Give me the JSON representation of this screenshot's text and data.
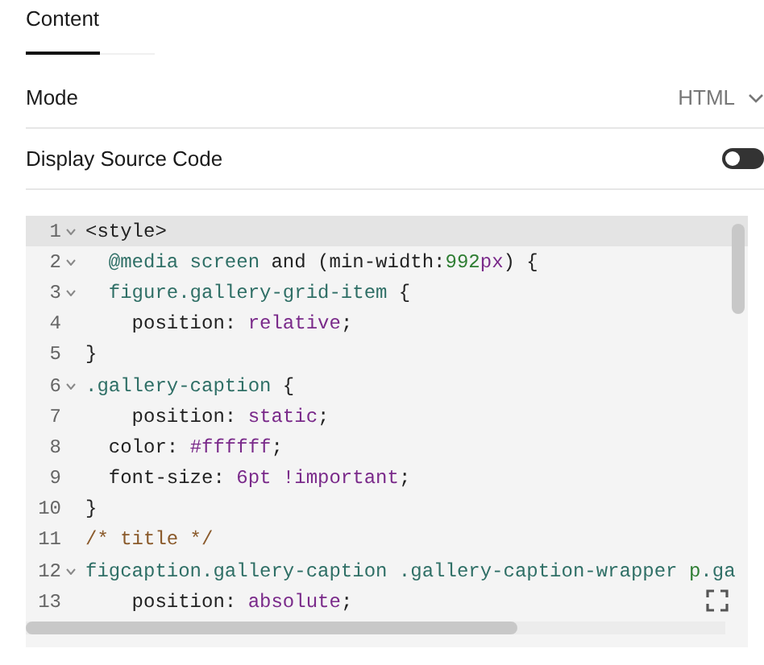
{
  "tabs": [
    {
      "label": "Content",
      "selected": true
    }
  ],
  "settings": [
    {
      "kind": "dropdown",
      "label": "Mode",
      "value": "HTML"
    },
    {
      "kind": "toggle",
      "label": "Display Source Code",
      "on": false
    }
  ],
  "editor": {
    "lines": [
      {
        "number": "1",
        "foldable": true,
        "active": true,
        "tokens": [
          {
            "kind": "tag",
            "text": "<style>"
          }
        ]
      },
      {
        "number": "2",
        "foldable": true,
        "active": false,
        "tokens": [
          {
            "kind": "selector",
            "text": "  @media screen"
          },
          {
            "kind": "plain",
            "text": " and ("
          },
          {
            "kind": "plain",
            "text": "min-width:"
          },
          {
            "kind": "number",
            "text": "992"
          },
          {
            "kind": "value",
            "text": "px"
          },
          {
            "kind": "plain",
            "text": ") {"
          }
        ]
      },
      {
        "number": "3",
        "foldable": true,
        "active": false,
        "tokens": [
          {
            "kind": "selector",
            "text": "  figure.gallery-grid-item"
          },
          {
            "kind": "plain",
            "text": " {"
          }
        ]
      },
      {
        "number": "4",
        "foldable": false,
        "active": false,
        "tokens": [
          {
            "kind": "plain",
            "text": "    position: "
          },
          {
            "kind": "value",
            "text": "relative"
          },
          {
            "kind": "plain",
            "text": ";"
          }
        ]
      },
      {
        "number": "5",
        "foldable": false,
        "active": false,
        "tokens": [
          {
            "kind": "plain",
            "text": "}"
          }
        ]
      },
      {
        "number": "6",
        "foldable": true,
        "active": false,
        "tokens": [
          {
            "kind": "selector",
            "text": ".gallery-caption"
          },
          {
            "kind": "plain",
            "text": " {"
          }
        ]
      },
      {
        "number": "7",
        "foldable": false,
        "active": false,
        "tokens": [
          {
            "kind": "plain",
            "text": "    position: "
          },
          {
            "kind": "value",
            "text": "static"
          },
          {
            "kind": "plain",
            "text": ";"
          }
        ]
      },
      {
        "number": "8",
        "foldable": false,
        "active": false,
        "tokens": [
          {
            "kind": "plain",
            "text": "  color: "
          },
          {
            "kind": "value",
            "text": "#ffffff"
          },
          {
            "kind": "plain",
            "text": ";"
          }
        ]
      },
      {
        "number": "9",
        "foldable": false,
        "active": false,
        "tokens": [
          {
            "kind": "plain",
            "text": "  font-size: "
          },
          {
            "kind": "value",
            "text": "6pt !important"
          },
          {
            "kind": "plain",
            "text": ";"
          }
        ]
      },
      {
        "number": "10",
        "foldable": false,
        "active": false,
        "tokens": [
          {
            "kind": "plain",
            "text": "}"
          }
        ]
      },
      {
        "number": "11",
        "foldable": false,
        "active": false,
        "tokens": [
          {
            "kind": "comment",
            "text": "/* title */"
          }
        ]
      },
      {
        "number": "12",
        "foldable": true,
        "active": false,
        "tokens": [
          {
            "kind": "selector",
            "text": "figcaption.gallery-caption .gallery-caption-wrapper "
          },
          {
            "kind": "number",
            "text": "p"
          },
          {
            "kind": "selector",
            "text": ".ga"
          }
        ]
      },
      {
        "number": "13",
        "foldable": false,
        "active": false,
        "tokens": [
          {
            "kind": "plain",
            "text": "    position: "
          },
          {
            "kind": "value",
            "text": "absolute"
          },
          {
            "kind": "plain",
            "text": ";"
          }
        ]
      }
    ]
  }
}
